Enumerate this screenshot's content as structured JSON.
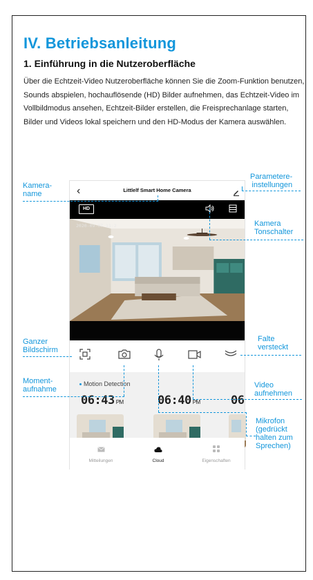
{
  "section_title": "IV. Betriebsanleitung",
  "subsection_title": "1. Einführung in die Nutzeroberfläche",
  "intro_paragraph": "Über die Echtzeit-Video Nutzeroberfläche können Sie die Zoom-Funktion benutzen, Sounds abspielen, hochauflösende (HD) Bilder aufnehmen, das Echtzeit-Video im Vollbildmodus ansehen, Echtzeit-Bilder erstellen, die Freisprechanlage starten, Bilder und Videos lokal speichern und den HD-Modus der Kamera auswählen.",
  "app": {
    "back_icon": "chevron-left-icon",
    "title": "Littlelf Smart Home Camera",
    "edit_icon": "pencil-icon",
    "hd_label": "HD",
    "video_timestamp": "2020-09-07 11:2",
    "controls": [
      "fullscreen-icon",
      "camera-icon",
      "microphone-icon",
      "video-camera-icon",
      "collapse-icon"
    ],
    "motion_label": "Motion Detection",
    "events": [
      {
        "time": "06:43",
        "ampm": "PM"
      },
      {
        "time": "06:40",
        "ampm": "PM"
      },
      {
        "time": "06",
        "ampm": ""
      }
    ],
    "tabs": [
      {
        "label": "Mitteilungen",
        "icon": "mail-icon",
        "active": false
      },
      {
        "label": "Cloud",
        "icon": "cloud-icon",
        "active": true
      },
      {
        "label": "Eigenschaften",
        "icon": "grid-icon",
        "active": false
      }
    ]
  },
  "callouts": {
    "camera_name": "Kamera-\nname",
    "settings": "Parametere-\ninstellungen",
    "sound_switch": "Kamera\nTonschalter",
    "fullscreen": "Ganzer\nBildschirm",
    "fold": "Falte\nversteckt",
    "snapshot": "Moment-\naufnahme",
    "record": "Video\naufnehmen",
    "mic": "Mikrofon\n(gedrückt\nhalten zum\nSprechen)"
  },
  "accent_color": "#1296db"
}
